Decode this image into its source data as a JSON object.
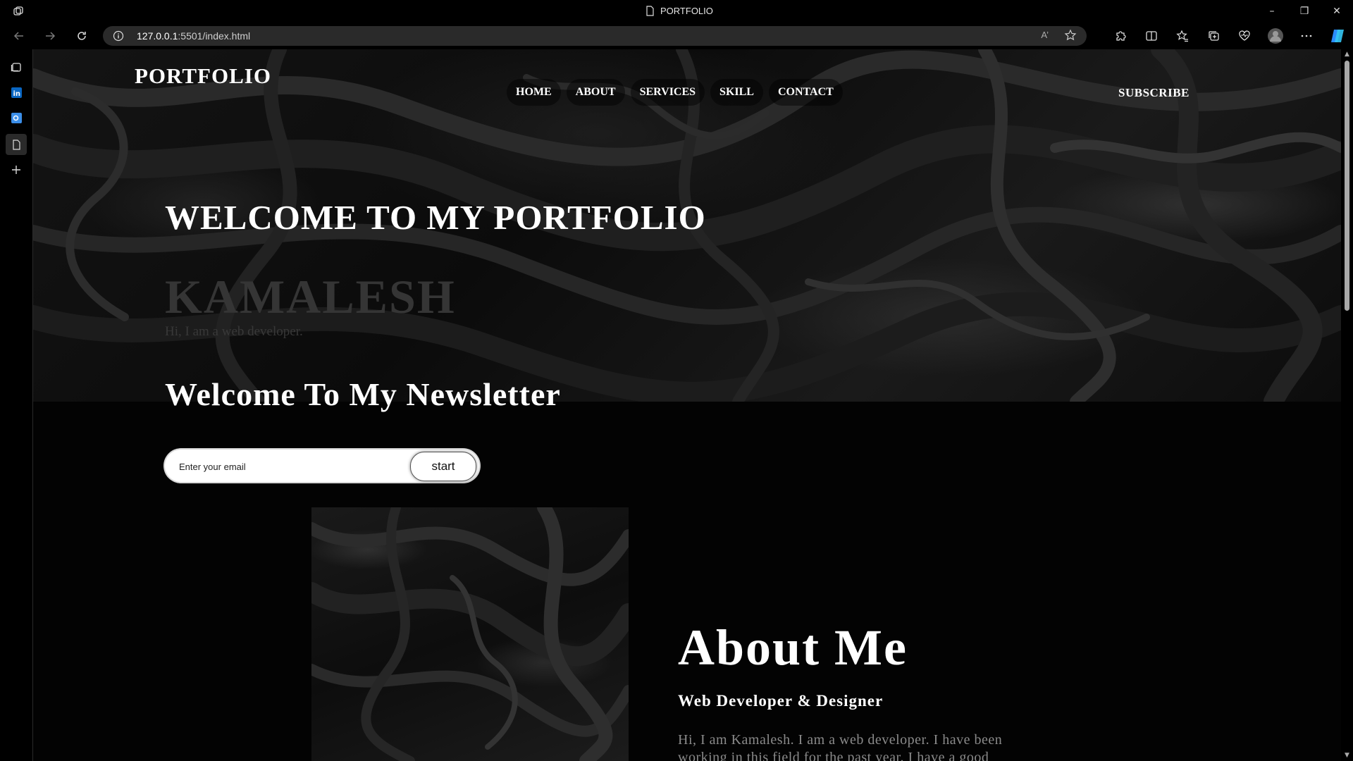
{
  "browser": {
    "tab_title": "PORTFOLIO",
    "url_host": "127.0.0.1",
    "url_rest": ":5501/index.html",
    "read_aloud": "A’",
    "window_controls": [
      "–",
      "❐",
      "✕"
    ]
  },
  "site": {
    "logo": "PORTFOLIO",
    "nav": [
      "HOME",
      "ABOUT",
      "SERVICES",
      "SKILL",
      "CONTACT"
    ],
    "subscribe": "SUBSCRIBE"
  },
  "hero": {
    "title": "WELCOME TO MY PORTFOLIO",
    "name": "KAMALESH",
    "subtitle": "Hi, I am a web developer."
  },
  "newsletter": {
    "title": "Welcome To My Newsletter",
    "email_placeholder": "Enter your email",
    "button": "start"
  },
  "about": {
    "title": "About Me",
    "role": "Web Developer & Designer",
    "text": "Hi, I am Kamalesh. I am a web developer. I have been working in this field for the past year. I have a good"
  },
  "colors": {
    "background": "#000000",
    "address_bar": "#2a2a2a",
    "muted_name": "#353535",
    "copilot_accent": "#2b8cff"
  }
}
